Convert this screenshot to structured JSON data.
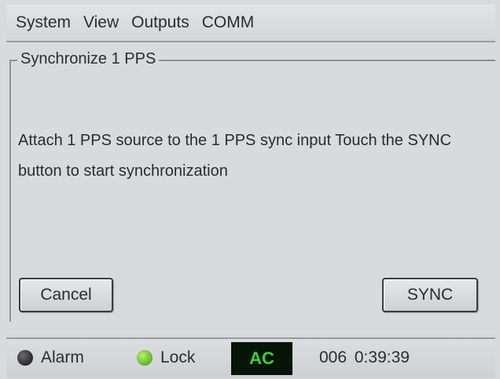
{
  "menu": {
    "items": [
      {
        "label": "System"
      },
      {
        "label": "View"
      },
      {
        "label": "Outputs"
      },
      {
        "label": "COMM"
      }
    ]
  },
  "dialog": {
    "title": "Synchronize 1 PPS",
    "message": "Attach 1 PPS source to the 1 PPS sync input Touch the SYNC button to start synchronization",
    "cancel_label": "Cancel",
    "sync_label": "SYNC"
  },
  "status": {
    "alarm_label": "Alarm",
    "alarm_color": "#2a2a2a",
    "lock_label": "Lock",
    "lock_color": "#5fb62a",
    "power_label": "AC",
    "power_color": "#3ed13e",
    "time": "006 0:39:39"
  }
}
